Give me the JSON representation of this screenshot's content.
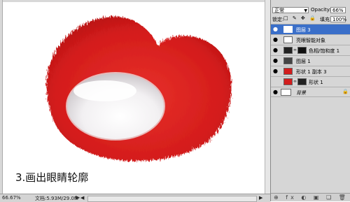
{
  "canvas": {
    "caption": "3.画出眼睛轮廓"
  },
  "status": {
    "zoom": "66.67%",
    "doc_info": "文档:5.93M/29.0M",
    "arrow": "▶",
    "scroll_left": "◀",
    "scroll_right": "▶"
  },
  "layers_panel": {
    "blend_mode": "正常",
    "opacity_label": "Opacity:",
    "opacity_value": "66%",
    "lock_label": "锁定:",
    "lock_icons": "□ ✎ ✥ 🔒",
    "fill_label": "填充:",
    "fill_value": "100%",
    "layers": [
      {
        "name": "图层 3",
        "selected": true,
        "visible": true
      },
      {
        "name": "亮眼智能对象",
        "selected": false,
        "visible": true
      },
      {
        "name": "色相/饱和度 1",
        "selected": false,
        "visible": true
      },
      {
        "name": "图层 1",
        "selected": false,
        "visible": true
      },
      {
        "name": "形状 1 副本 3",
        "selected": false,
        "visible": true
      },
      {
        "name": "形状 1",
        "selected": false,
        "visible": false
      },
      {
        "name": "背景",
        "selected": false,
        "visible": true
      }
    ],
    "bottom_icons": "⊕ fx ◐ ▣ ❏ 🗑"
  },
  "colors": {
    "fur_red": "#d61f1f",
    "selection_blue": "#3a6fc9"
  }
}
